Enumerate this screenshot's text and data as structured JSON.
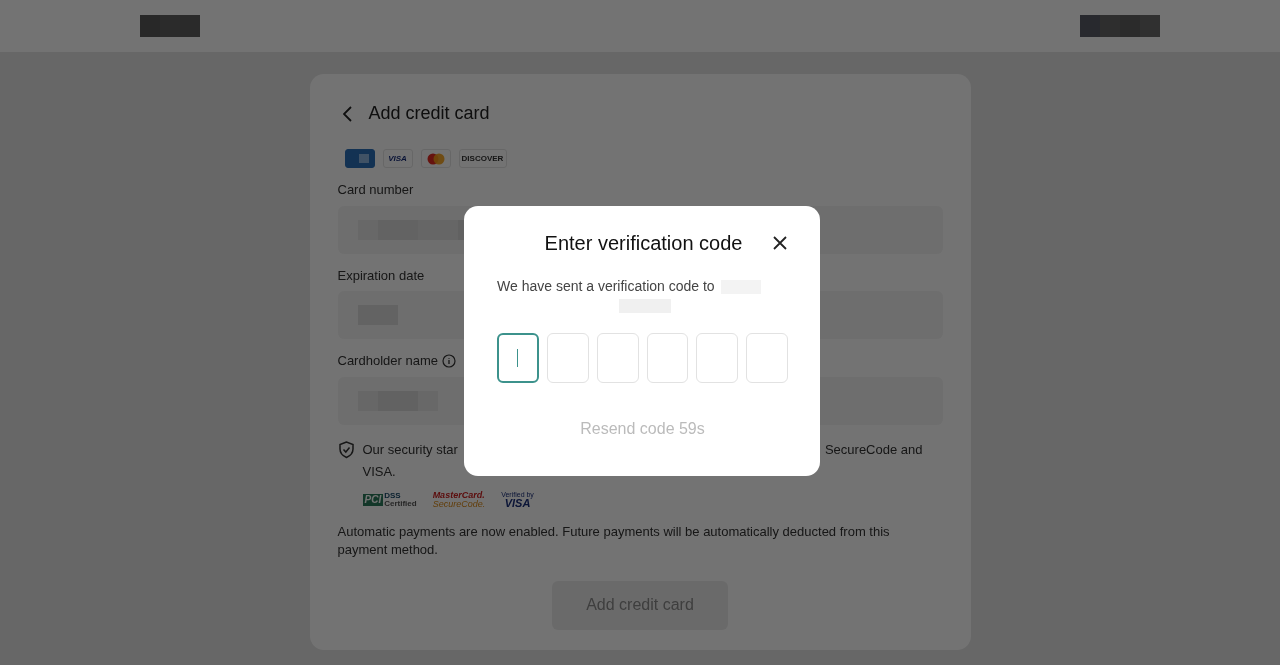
{
  "page": {
    "title": "Add credit card",
    "card_brands": [
      {
        "kind": "amex"
      },
      {
        "kind": "visa",
        "text": "VISA"
      },
      {
        "kind": "mastercard"
      },
      {
        "kind": "discover",
        "text": "DISCOVER"
      }
    ],
    "fields": [
      {
        "label": "Card number",
        "info": false
      },
      {
        "label": "Expiration date",
        "info": false
      },
      {
        "label": "Cardholder name",
        "info": true
      }
    ],
    "security_text": {
      "start": "Our security star",
      "end": "SecureCode and",
      "line_2": "VISA."
    },
    "security_badges": [
      {
        "kind": "pci",
        "lines": [
          "PCI",
          "DSS",
          "Certified"
        ]
      },
      {
        "kind": "mastercard",
        "lines": [
          "MasterCard.",
          "SecureCode."
        ]
      },
      {
        "kind": "visa",
        "lines": [
          "Verified by",
          "VISA"
        ]
      }
    ],
    "autopay_note": "Automatic payments are now enabled. Future payments will be automatically deducted from this payment method.",
    "submit_button": {
      "label": "Add credit card",
      "disabled": true
    }
  },
  "dialog": {
    "title": "Enter verification code",
    "message": "We have sent a verification code to",
    "code_boxes": [
      {
        "selected": true
      },
      {
        "selected": false
      },
      {
        "selected": false
      },
      {
        "selected": false
      },
      {
        "selected": false
      },
      {
        "selected": false
      }
    ],
    "resend": {
      "label": "Resend code 59s",
      "disabled": true
    }
  }
}
